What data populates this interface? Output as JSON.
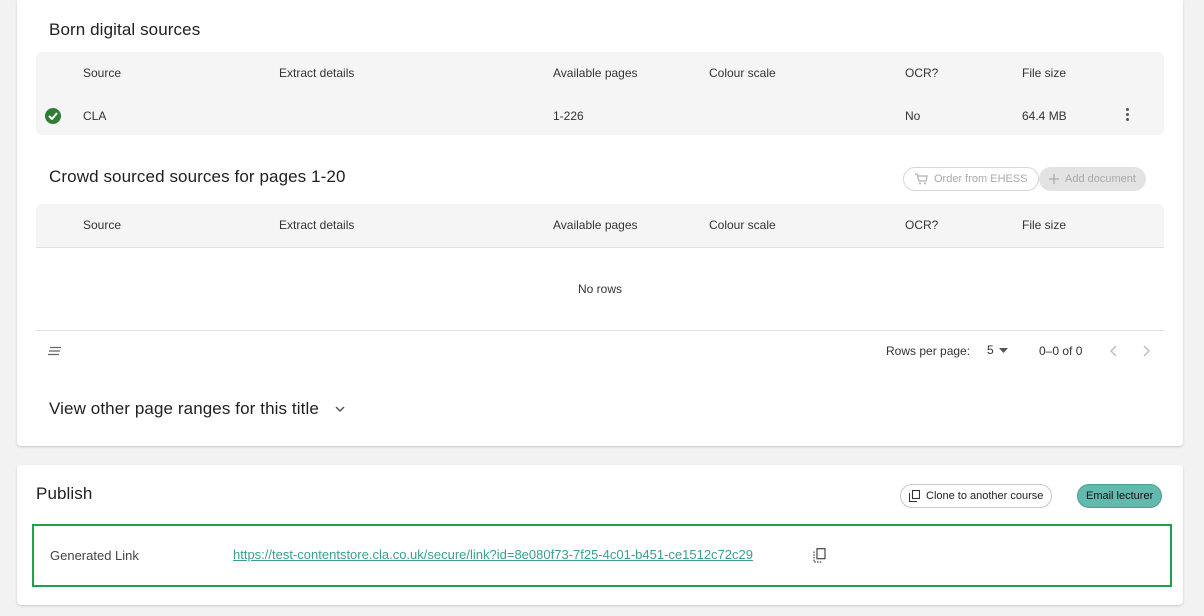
{
  "born_digital": {
    "title": "Born digital sources",
    "columns": [
      "Source",
      "Extract details",
      "Available pages",
      "Colour scale",
      "OCR?",
      "File size"
    ],
    "row": {
      "source": "CLA",
      "extract_details": "",
      "available_pages": "1-226",
      "colour_scale": "",
      "ocr": "No",
      "file_size": "64.4 MB"
    }
  },
  "crowd_sourced": {
    "title": "Crowd sourced sources for pages 1-20",
    "order_button": "Order from EHESS",
    "add_button": "Add document",
    "columns": [
      "Source",
      "Extract details",
      "Available pages",
      "Colour scale",
      "OCR?",
      "File size"
    ],
    "empty_text": "No rows",
    "rows_per_page_label": "Rows per page:",
    "rows_per_page_value": "5",
    "range_text": "0–0 of 0"
  },
  "other_ranges": {
    "title": "View other page ranges for this title"
  },
  "publish": {
    "title": "Publish",
    "clone_button": "Clone to another course",
    "email_button": "Email lecturer",
    "link_label": "Generated Link",
    "link_url": "https://test-contentstore.cla.co.uk/secure/link?id=8e080f73-7f25-4c01-b451-ce1512c72c29"
  },
  "colors": {
    "accent": "#62b9ae",
    "success": "#2e7d32",
    "highlight_border": "#1fa14b",
    "link": "#3a9e93"
  },
  "icons": [
    "check-circle-icon",
    "more-vert-icon",
    "cart-icon",
    "plus-icon",
    "density-icon",
    "dropdown-icon",
    "chevron-left-icon",
    "chevron-right-icon",
    "chevron-down-icon",
    "copy-icon"
  ]
}
